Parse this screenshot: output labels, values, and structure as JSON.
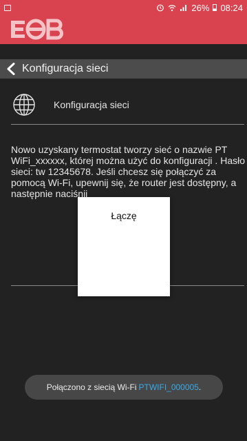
{
  "status_bar": {
    "alarm_icon": "alarm-icon",
    "wifi_icon": "wifi-icon",
    "signal_icon": "signal-icon",
    "battery": "26%",
    "time": "08:24"
  },
  "app": {
    "logo_text": "EOB",
    "brand_color": "#d9434f"
  },
  "header": {
    "back_icon": "chevron-left-icon",
    "title": "Konfiguracja sieci"
  },
  "section": {
    "icon": "globe-icon",
    "title": "Konfiguracja sieci"
  },
  "description": {
    "before": "Nowo uzyskany termostat tworzy sieć o nazwie PT WiFi_xxxxxx, której można użyć do konfiguracji . Hasło sieci: tw 12345678. Jeśli chcesz się połączyć za pomocą Wi-Fi, upewnij się, że router jest dostępny, a następnie naciśnij"
  },
  "dialog": {
    "message": "Łączę"
  },
  "toast": {
    "message": "Połączono z siecią Wi-Fi",
    "ssid": "PTWIFI_000005",
    "suffix": ".",
    "ssid_color": "#3aa9e6"
  }
}
